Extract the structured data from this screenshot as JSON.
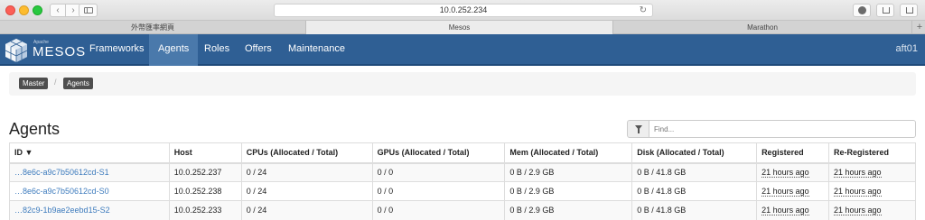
{
  "browser": {
    "url": "10.0.252.234",
    "tabs": [
      "外幣匯率網頁",
      "Mesos",
      "Marathon"
    ],
    "add_tab": "+"
  },
  "navbar": {
    "brand_small": "Apache",
    "brand": "MESOS",
    "items": [
      "Frameworks",
      "Agents",
      "Roles",
      "Offers",
      "Maintenance"
    ],
    "active": "Agents",
    "user": "aft01"
  },
  "breadcrumb": [
    "Master",
    "Agents"
  ],
  "page": {
    "title": "Agents",
    "search_placeholder": "Find..."
  },
  "table": {
    "columns": [
      "ID ▼",
      "Host",
      "CPUs (Allocated / Total)",
      "GPUs (Allocated / Total)",
      "Mem (Allocated / Total)",
      "Disk (Allocated / Total)",
      "Registered",
      "Re-Registered"
    ],
    "rows": [
      [
        "…8e6c-a9c7b50612cd-S1",
        "10.0.252.237",
        "0 / 24",
        "0 / 0",
        "0 B / 2.9 GB",
        "0 B / 41.8 GB",
        "21 hours ago",
        "21 hours ago"
      ],
      [
        "…8e6c-a9c7b50612cd-S0",
        "10.0.252.238",
        "0 / 24",
        "0 / 0",
        "0 B / 2.9 GB",
        "0 B / 41.8 GB",
        "21 hours ago",
        "21 hours ago"
      ],
      [
        "…82c9-1b9ae2eebd15-S2",
        "10.0.252.233",
        "0 / 24",
        "0 / 0",
        "0 B / 2.9 GB",
        "0 B / 41.8 GB",
        "21 hours ago",
        "21 hours ago"
      ]
    ]
  },
  "colors": {
    "navbar": "#2f5f94",
    "navbar_active": "#4a79ab",
    "link": "#3d7bbd"
  }
}
